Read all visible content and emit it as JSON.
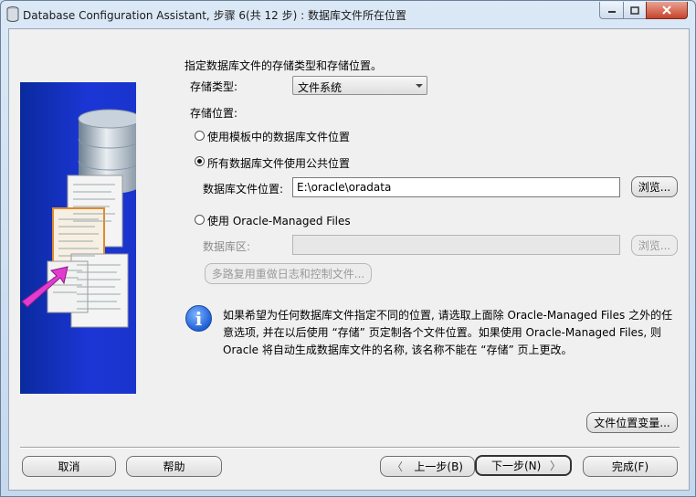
{
  "window": {
    "title": "Database Configuration Assistant, 步骤 6(共 12 步) : 数据库文件所在位置"
  },
  "header_text": "指定数据库文件的存储类型和存储位置。",
  "storage_type": {
    "label": "存储类型:",
    "value": "文件系统"
  },
  "storage_location": {
    "label": "存储位置:",
    "option_template": "使用模板中的数据库文件位置",
    "option_common": "所有数据库文件使用公共位置",
    "file_location_label": "数据库文件位置:",
    "file_location_value": "E:\\oracle\\oradata",
    "browse_label": "浏览...",
    "option_omf": "使用 Oracle-Managed Files",
    "db_area_label": "数据库区:",
    "db_area_value": "",
    "browse2_label": "浏览...",
    "multiplex_label": "多路复用重做日志和控制文件..."
  },
  "info": {
    "text": "如果希望为任何数据库文件指定不同的位置, 请选取上面除 Oracle-Managed Files 之外的任意选项, 并在以后使用 “存储” 页定制各个文件位置。如果使用 Oracle-Managed Files, 则 Oracle 将自动生成数据库文件的名称, 该名称不能在 “存储” 页上更改。"
  },
  "buttons": {
    "file_location_vars": "文件位置变量...",
    "cancel": "取消",
    "help": "帮助",
    "back": "上一步(B)",
    "next": "下一步(N)",
    "finish": "完成(F)"
  },
  "selected_option": "option_common",
  "icons": [
    "database-icon",
    "info-icon",
    "minimize-icon",
    "maximize-icon",
    "close-icon",
    "back-arrow-icon",
    "next-arrow-icon"
  ]
}
